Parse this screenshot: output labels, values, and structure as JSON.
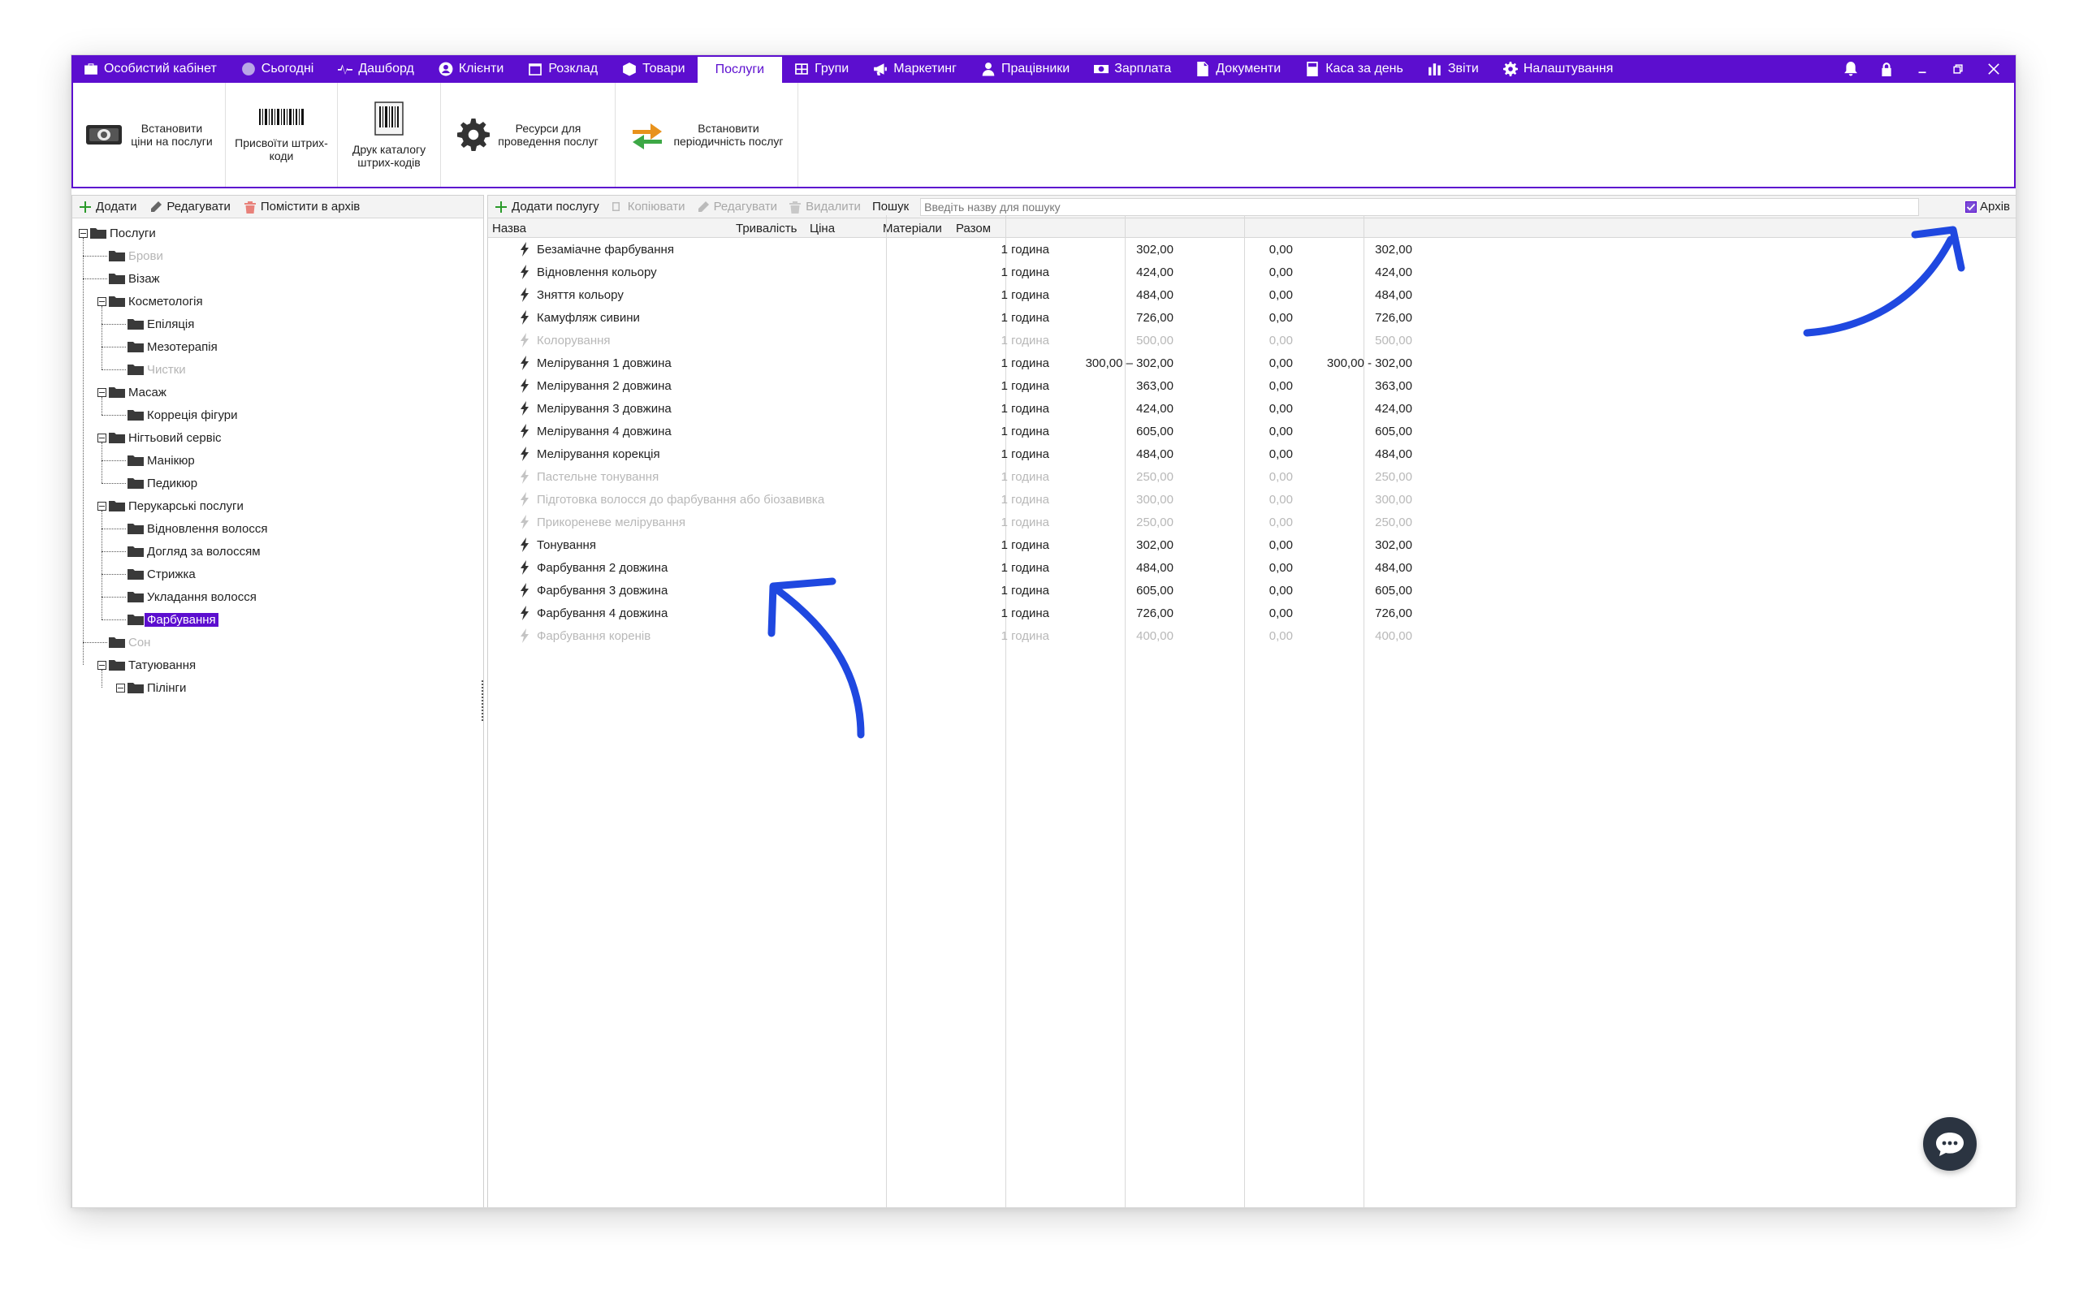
{
  "nav": {
    "items": [
      {
        "label": "Особистий кабінет",
        "icon": "briefcase-icon"
      },
      {
        "label": "Сьогодні",
        "icon": "clock-icon"
      },
      {
        "label": "Дашборд",
        "icon": "pulse-icon"
      },
      {
        "label": "Клієнти",
        "icon": "user-circle-icon"
      },
      {
        "label": "Розклад",
        "icon": "calendar-icon"
      },
      {
        "label": "Товари",
        "icon": "box-icon"
      },
      {
        "label": "Послуги",
        "icon": "",
        "active": true
      },
      {
        "label": "Групи",
        "icon": "grid-icon"
      },
      {
        "label": "Маркетинг",
        "icon": "megaphone-icon"
      },
      {
        "label": "Працівники",
        "icon": "person-icon"
      },
      {
        "label": "Зарплата",
        "icon": "money-icon"
      },
      {
        "label": "Документи",
        "icon": "document-icon"
      },
      {
        "label": "Каса за день",
        "icon": "calculator-icon"
      },
      {
        "label": "Звіти",
        "icon": "bar-chart-icon"
      },
      {
        "label": "Налаштування",
        "icon": "gear-icon"
      }
    ]
  },
  "ribbon": {
    "set_prices": "Встановити\nціни на послуги",
    "assign_barcodes": "Присвоїти штрих-\nкоди",
    "print_catalog": "Друк каталогу\nштрих-кодів",
    "resources": "Ресурси для\nпроведення послуг",
    "periodicity": "Встановити\nперіодичність послуг"
  },
  "left_toolbar": {
    "add": "Додати",
    "edit": "Редагувати",
    "archive": "Помістити в архів"
  },
  "tree": [
    {
      "label": "Послуги",
      "level": 0,
      "expander": true
    },
    {
      "label": "Брови",
      "level": 1,
      "archived": true
    },
    {
      "label": "Візаж",
      "level": 1
    },
    {
      "label": "Косметологія",
      "level": 1,
      "expander": true
    },
    {
      "label": "Епіляція",
      "level": 2
    },
    {
      "label": "Мезотерапія",
      "level": 2
    },
    {
      "label": "Чистки",
      "level": 2,
      "archived": true
    },
    {
      "label": "Масаж",
      "level": 1,
      "expander": true
    },
    {
      "label": "Корреція фігури",
      "level": 2
    },
    {
      "label": "Нігтьовий сервіс",
      "level": 1,
      "expander": true
    },
    {
      "label": "Манікюр",
      "level": 2
    },
    {
      "label": "Педикюр",
      "level": 2
    },
    {
      "label": "Перукарські послуги",
      "level": 1,
      "expander": true
    },
    {
      "label": "Відновлення волосся",
      "level": 2
    },
    {
      "label": "Догляд за волоссям",
      "level": 2
    },
    {
      "label": "Стрижка",
      "level": 2
    },
    {
      "label": "Укладання волосся",
      "level": 2
    },
    {
      "label": "Фарбування",
      "level": 2,
      "selected": true
    },
    {
      "label": "Сон",
      "level": 1,
      "archived": true
    },
    {
      "label": "Татуювання",
      "level": 1,
      "expander": true
    },
    {
      "label": "Пілінги",
      "level": 2,
      "expander": true
    }
  ],
  "right_toolbar": {
    "add_service": "Додати послугу",
    "copy": "Копіювати",
    "edit": "Редагувати",
    "delete": "Видалити",
    "search_label": "Пошук",
    "search_placeholder": "Введіть назву для пошуку",
    "archive_label": "Архів",
    "archive_checked": true
  },
  "columns": {
    "name": "Назва",
    "duration": "Тривалість",
    "price": "Ціна",
    "materials": "Матеріали",
    "total": "Разом"
  },
  "services": [
    {
      "name": "Безаміачне фарбування",
      "duration": "1 година",
      "price": "302,00",
      "materials": "0,00",
      "total": "302,00",
      "archived": false
    },
    {
      "name": "Відновлення кольору",
      "duration": "1 година",
      "price": "424,00",
      "materials": "0,00",
      "total": "424,00",
      "archived": false
    },
    {
      "name": "Зняття кольору",
      "duration": "1 година",
      "price": "484,00",
      "materials": "0,00",
      "total": "484,00",
      "archived": false
    },
    {
      "name": "Камуфляж сивини",
      "duration": "1 година",
      "price": "726,00",
      "materials": "0,00",
      "total": "726,00",
      "archived": false
    },
    {
      "name": "Колорування",
      "duration": "1 година",
      "price": "500,00",
      "materials": "0,00",
      "total": "500,00",
      "archived": true
    },
    {
      "name": "Мелірування 1 довжина",
      "duration": "1 година",
      "price": "300,00 – 302,00",
      "materials": "0,00",
      "total": "300,00 - 302,00",
      "archived": false
    },
    {
      "name": "Мелірування 2 довжина",
      "duration": "1 година",
      "price": "363,00",
      "materials": "0,00",
      "total": "363,00",
      "archived": false
    },
    {
      "name": "Мелірування 3 довжина",
      "duration": "1 година",
      "price": "424,00",
      "materials": "0,00",
      "total": "424,00",
      "archived": false
    },
    {
      "name": "Мелірування 4 довжина",
      "duration": "1 година",
      "price": "605,00",
      "materials": "0,00",
      "total": "605,00",
      "archived": false
    },
    {
      "name": "Мелірування корекція",
      "duration": "1 година",
      "price": "484,00",
      "materials": "0,00",
      "total": "484,00",
      "archived": false
    },
    {
      "name": "Пастельне тонування",
      "duration": "1 година",
      "price": "250,00",
      "materials": "0,00",
      "total": "250,00",
      "archived": true
    },
    {
      "name": "Підготовка волосся до фарбування або біозавивка",
      "duration": "1 година",
      "price": "300,00",
      "materials": "0,00",
      "total": "300,00",
      "archived": true
    },
    {
      "name": "Прикореневе мелірування",
      "duration": "1 година",
      "price": "250,00",
      "materials": "0,00",
      "total": "250,00",
      "archived": true
    },
    {
      "name": "Тонування",
      "duration": "1 година",
      "price": "302,00",
      "materials": "0,00",
      "total": "302,00",
      "archived": false
    },
    {
      "name": "Фарбування 2 довжина",
      "duration": "1 година",
      "price": "484,00",
      "materials": "0,00",
      "total": "484,00",
      "archived": false
    },
    {
      "name": "Фарбування 3 довжина",
      "duration": "1 година",
      "price": "605,00",
      "materials": "0,00",
      "total": "605,00",
      "archived": false
    },
    {
      "name": "Фарбування 4 довжина",
      "duration": "1 година",
      "price": "726,00",
      "materials": "0,00",
      "total": "726,00",
      "archived": false
    },
    {
      "name": "Фарбування коренів",
      "duration": "1 година",
      "price": "400,00",
      "materials": "0,00",
      "total": "400,00",
      "archived": true
    }
  ],
  "colors": {
    "accent": "#5c0ecf",
    "annotation_arrow": "#1f48e0",
    "archived_text": "#b8b8b8"
  }
}
